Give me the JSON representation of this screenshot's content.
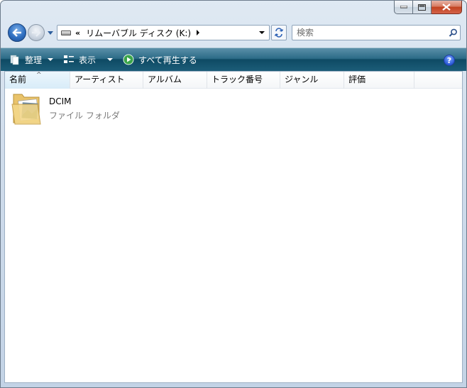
{
  "address_bar": {
    "overflow_chevron": "«",
    "breadcrumb": "リムーバブル ディスク (K:)"
  },
  "search": {
    "placeholder": "検索"
  },
  "toolbar": {
    "organize_label": "整理",
    "view_label": "表示",
    "play_all_label": "すべて再生する",
    "help_symbol": "?"
  },
  "columns": [
    {
      "label": "名前"
    },
    {
      "label": "アーティスト"
    },
    {
      "label": "アルバム"
    },
    {
      "label": "トラック番号"
    },
    {
      "label": "ジャンル"
    },
    {
      "label": "評価"
    }
  ],
  "sort_indicator": "^",
  "items": [
    {
      "name": "DCIM",
      "type": "ファイル フォルダ",
      "icon": "folder-icon"
    }
  ]
}
